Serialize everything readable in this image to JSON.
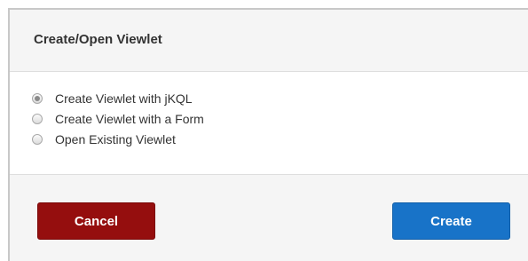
{
  "dialog": {
    "title": "Create/Open Viewlet",
    "options": [
      {
        "label": "Create Viewlet with jKQL",
        "checked": true
      },
      {
        "label": "Create Viewlet with a Form",
        "checked": false
      },
      {
        "label": "Open Existing Viewlet",
        "checked": false
      }
    ],
    "cancel_label": "Cancel",
    "create_label": "Create"
  },
  "colors": {
    "cancel_button": "#950e0e",
    "create_button": "#1873c8"
  }
}
